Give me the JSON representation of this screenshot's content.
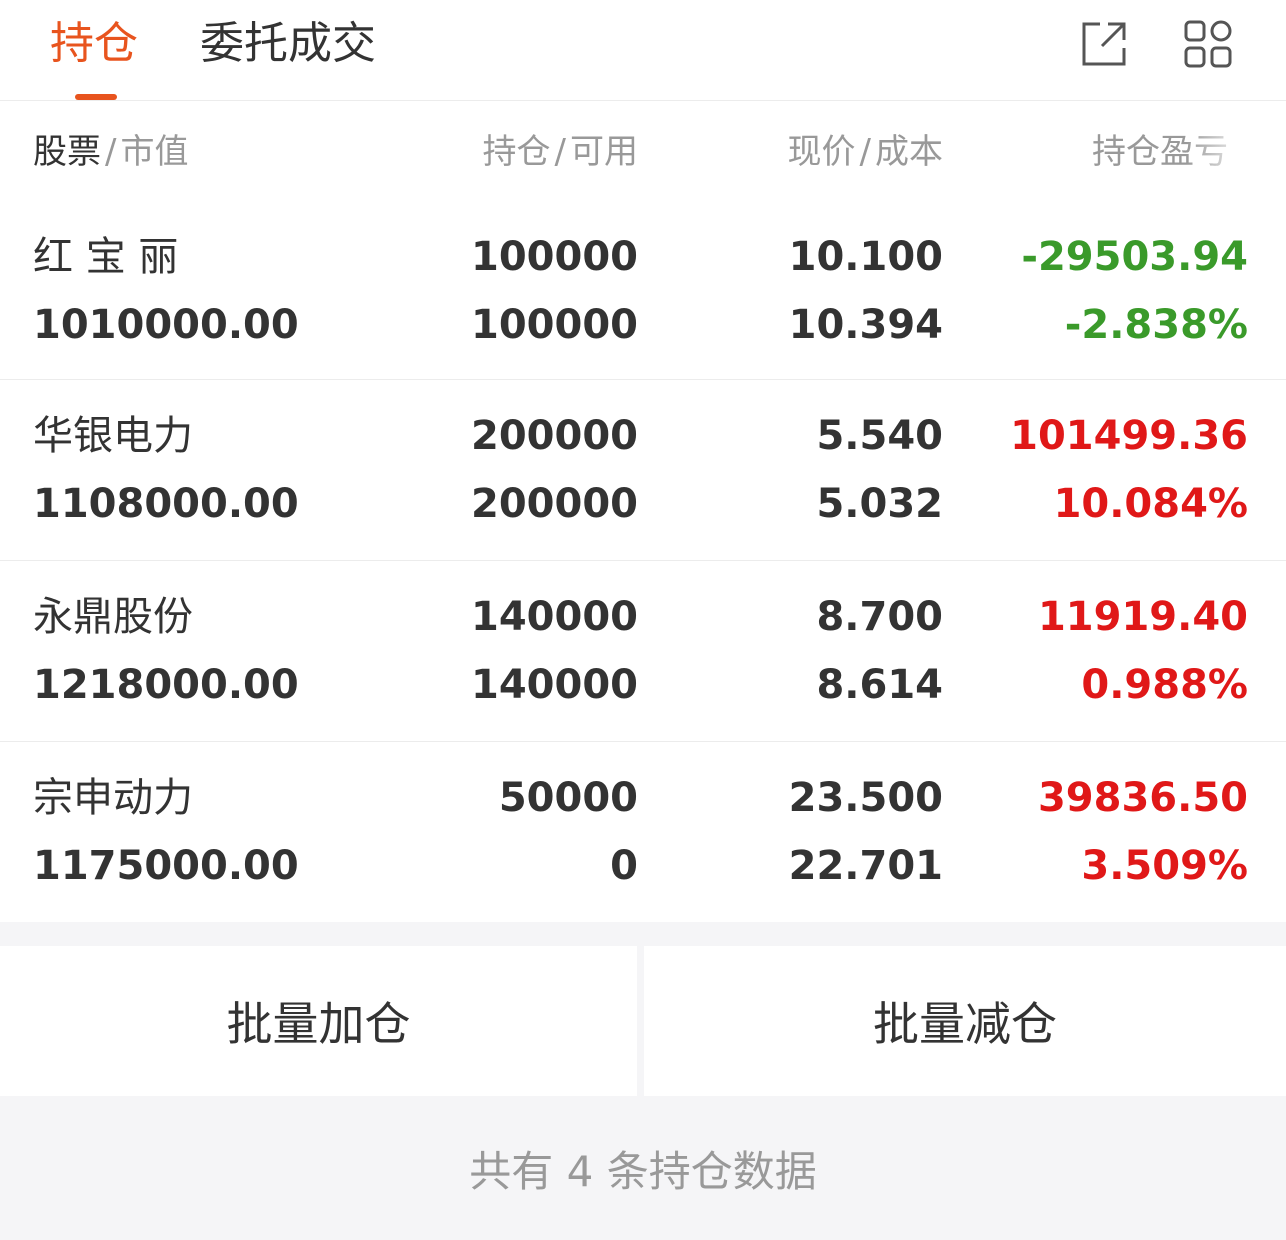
{
  "tabs": [
    {
      "label": "持仓",
      "active": true
    },
    {
      "label": "委托成交",
      "active": false
    }
  ],
  "top_icons": [
    "share-icon",
    "grid-icon"
  ],
  "columns": {
    "stock": "股票",
    "market_value": "市值",
    "position": "持仓",
    "available": "可用",
    "price": "现价",
    "cost": "成本",
    "pnl": "持仓盈亏"
  },
  "holdings": [
    {
      "name": "红 宝 丽",
      "market_value": "1010000.00",
      "position": "100000",
      "available": "100000",
      "price": "10.100",
      "cost": "10.394",
      "pnl": "-29503.94",
      "pnl_pct": "-2.838%",
      "trend": "down"
    },
    {
      "name": "华银电力",
      "market_value": "1108000.00",
      "position": "200000",
      "available": "200000",
      "price": "5.540",
      "cost": "5.032",
      "pnl": "101499.36",
      "pnl_pct": "10.084%",
      "trend": "up"
    },
    {
      "name": "永鼎股份",
      "market_value": "1218000.00",
      "position": "140000",
      "available": "140000",
      "price": "8.700",
      "cost": "8.614",
      "pnl": "11919.40",
      "pnl_pct": "0.988%",
      "trend": "up"
    },
    {
      "name": "宗申动力",
      "market_value": "1175000.00",
      "position": "50000",
      "available": "0",
      "price": "23.500",
      "cost": "22.701",
      "pnl": "39836.50",
      "pnl_pct": "3.509%",
      "trend": "up"
    }
  ],
  "buttons": {
    "batch_add": "批量加仓",
    "batch_reduce": "批量减仓"
  },
  "footer": "共有 4 条持仓数据",
  "colors": {
    "accent": "#e8541e",
    "gain": "#e01818",
    "loss": "#3a9a2a"
  }
}
